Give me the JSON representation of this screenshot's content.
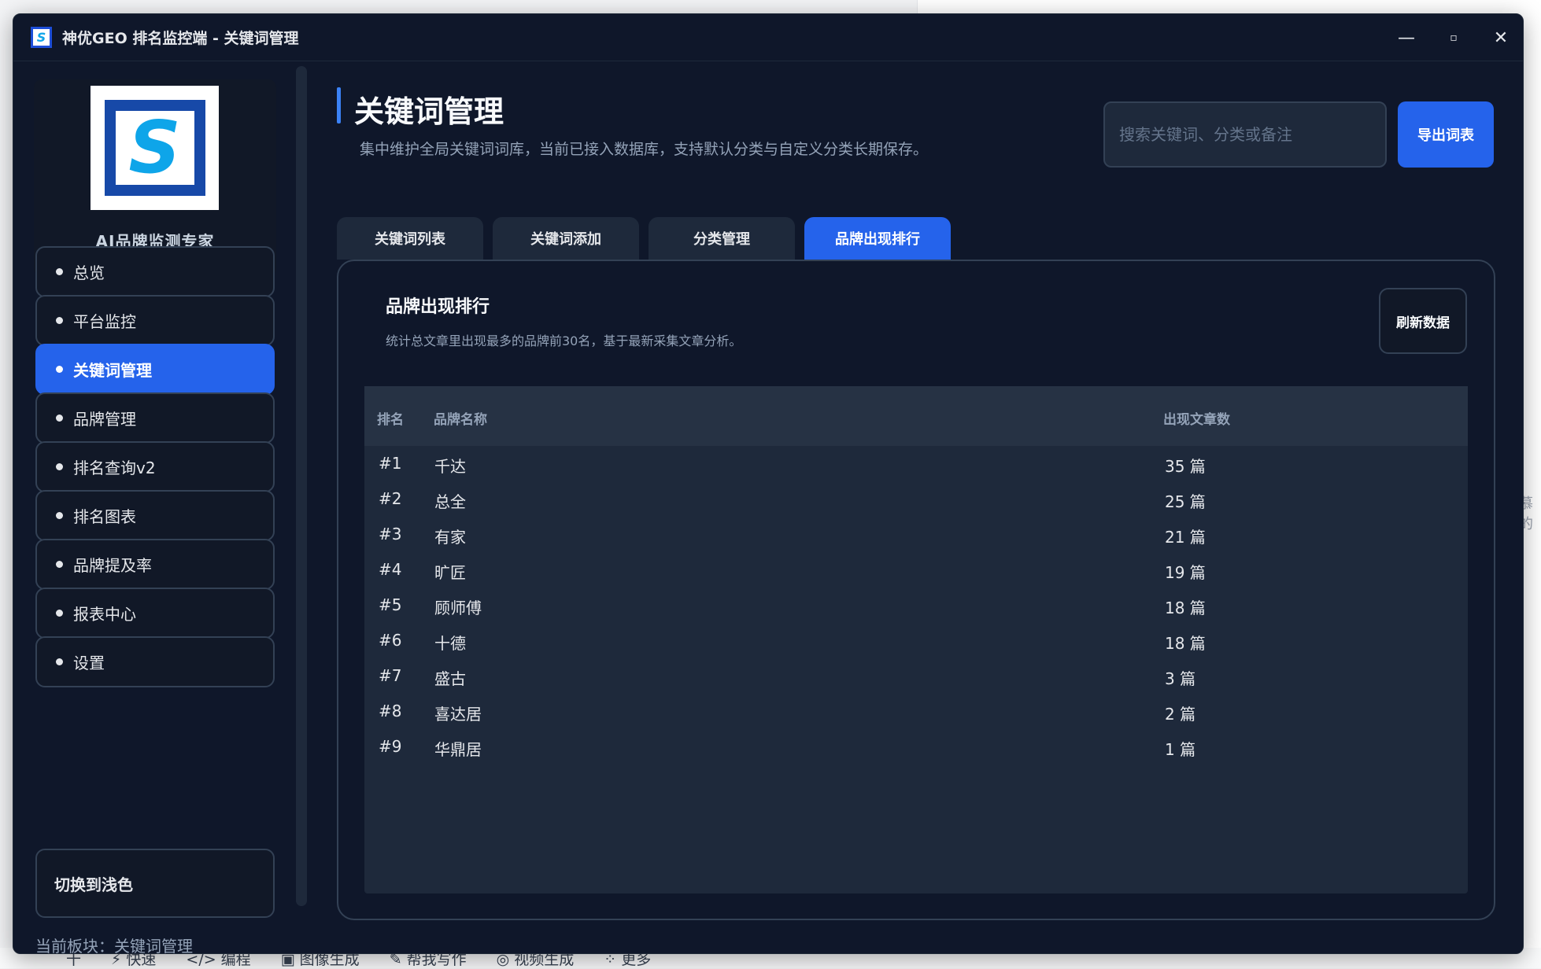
{
  "window": {
    "title": "神优GEO 排名监控端 - 关键词管理",
    "icon_letter": "S",
    "controls": [
      "—",
      "▫",
      "✕"
    ]
  },
  "background": {
    "peek_text": "慕的",
    "taskbar_items": [
      "十",
      "⚡ 快速",
      "</> 编程",
      "▣ 图像生成",
      "✎ 帮我写作",
      "◎ 视频生成",
      "⁘ 更多"
    ]
  },
  "sidebar": {
    "logo_text": "S",
    "logo_subtitle": "AI品牌监测专家",
    "nav": [
      {
        "label": "总览",
        "active": false
      },
      {
        "label": "平台监控",
        "active": false
      },
      {
        "label": "关键词管理",
        "active": true
      },
      {
        "label": "品牌管理",
        "active": false
      },
      {
        "label": "排名查询v2",
        "active": false
      },
      {
        "label": "排名图表",
        "active": false
      },
      {
        "label": "品牌提及率",
        "active": false
      },
      {
        "label": "报表中心",
        "active": false
      },
      {
        "label": "设置",
        "active": false
      }
    ],
    "theme_toggle": "切换到浅色",
    "current_block": "当前板块：关键词管理"
  },
  "header": {
    "title": "关键词管理",
    "description": "集中维护全局关键词词库，当前已接入数据库，支持默认分类与自定义分类长期保存。",
    "search_placeholder": "搜索关键词、分类或备注",
    "export_label": "导出词表"
  },
  "tabs": [
    {
      "label": "关键词列表",
      "active": false
    },
    {
      "label": "关键词添加",
      "active": false
    },
    {
      "label": "分类管理",
      "active": false
    },
    {
      "label": "品牌出现排行",
      "active": true
    }
  ],
  "panel": {
    "title": "品牌出现排行",
    "description": "统计总文章里出现最多的品牌前30名，基于最新采集文章分析。",
    "refresh_label": "刷新数据",
    "columns": {
      "rank": "排名",
      "brand": "品牌名称",
      "count": "出现文章数"
    },
    "rows": [
      {
        "rank": "#1",
        "brand": "千达",
        "count": "35 篇"
      },
      {
        "rank": "#2",
        "brand": "总全",
        "count": "25 篇"
      },
      {
        "rank": "#3",
        "brand": "有家",
        "count": "21 篇"
      },
      {
        "rank": "#4",
        "brand": "旷匠",
        "count": "19 篇"
      },
      {
        "rank": "#5",
        "brand": "顾师傅",
        "count": "18 篇"
      },
      {
        "rank": "#6",
        "brand": "十德",
        "count": "18 篇"
      },
      {
        "rank": "#7",
        "brand": "盛古",
        "count": "3 篇"
      },
      {
        "rank": "#8",
        "brand": "喜达居",
        "count": "2 篇"
      },
      {
        "rank": "#9",
        "brand": "华鼎居",
        "count": "1 篇"
      }
    ]
  }
}
